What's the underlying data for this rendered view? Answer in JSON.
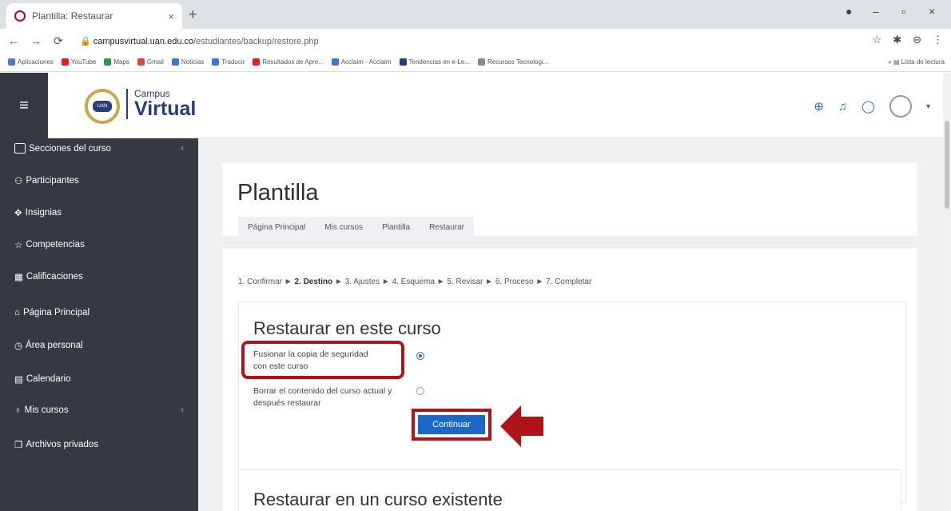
{
  "browser": {
    "tab_title": "Plantilla: Restaurar",
    "tab_close": "×",
    "new_tab": "+",
    "url_host": "campusvirtual.uan.edu.co",
    "url_path": "/estudiantes/backup/restore.php",
    "bookmarks": [
      {
        "label": "Aplicaciones",
        "color": "#4a7bd0"
      },
      {
        "label": "YouTube",
        "color": "#e02020"
      },
      {
        "label": "Maps",
        "color": "#2d9a4e"
      },
      {
        "label": "Gmail",
        "color": "#d84a3a"
      },
      {
        "label": "Noticias",
        "color": "#3a78d0"
      },
      {
        "label": "Traducir",
        "color": "#3a78d0"
      },
      {
        "label": "Resultados de Apre...",
        "color": "#e02020"
      },
      {
        "label": "Acclaim - Acclaim",
        "color": "#3a78d0"
      },
      {
        "label": "Tendencias en e-Le...",
        "color": "#2b3c7a"
      },
      {
        "label": "Recursos Tecnologi...",
        "color": "#888888"
      }
    ],
    "reading_list": "Lista de lectura"
  },
  "header": {
    "logo_text": "UAN",
    "brand_small": "Campus",
    "brand_big": "Virtual"
  },
  "sidebar": {
    "items": [
      {
        "label": "Secciones del curso"
      },
      {
        "label": "Participantes"
      },
      {
        "label": "Insignias"
      },
      {
        "label": "Competencias"
      },
      {
        "label": "Calificaciones"
      },
      {
        "label": "Página Principal"
      },
      {
        "label": "Área personal"
      },
      {
        "label": "Calendario"
      },
      {
        "label": "Mis cursos"
      },
      {
        "label": "Archivos privados"
      }
    ]
  },
  "main": {
    "title": "Plantilla",
    "breadcrumbs": [
      "Página Principal",
      "Mis cursos",
      "Plantilla",
      "Restaurar"
    ],
    "steps_prefix": "1. Confirmar ► ",
    "steps_current": "2. Destino",
    "steps_suffix": " ► 3. Ajustes ► 4. Esquema ► 5. Revisar ► 6. Proceso ► 7. Completar",
    "section_title": "Restaurar en este curso",
    "option_merge": "Fusionar la copia de seguridad con este curso",
    "option_delete": "Borrar el contenido del curso actual y después restaurar",
    "continue_button": "Continuar",
    "section2_title": "Restaurar en un curso existente"
  },
  "colors": {
    "highlight": "#b0141b",
    "primary": "#1a68c8",
    "sidebar_bg": "#343a40"
  }
}
